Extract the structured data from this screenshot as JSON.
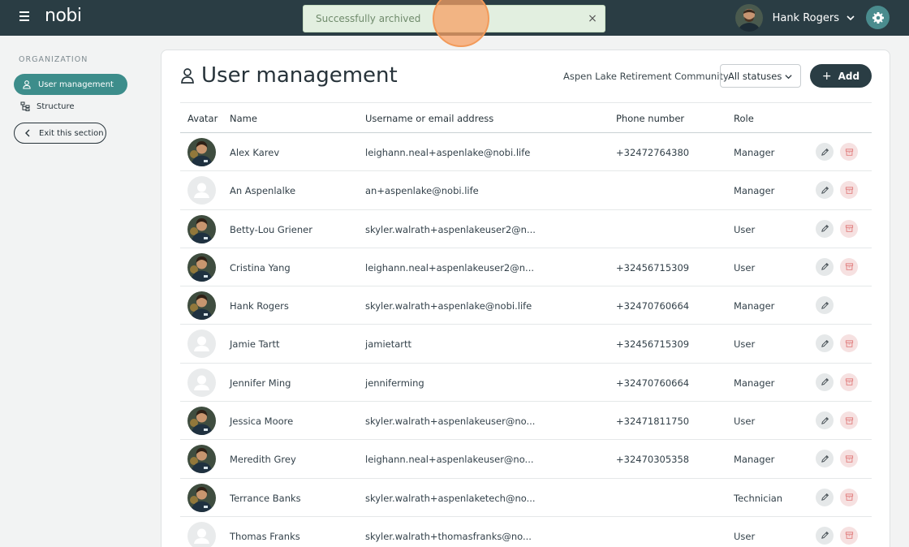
{
  "header": {
    "logo": "nobi",
    "user_name": "Hank Rogers",
    "brand_color": "#2a3d44",
    "accent_color": "#3d8d8b"
  },
  "toast": {
    "message": "Successfully archived",
    "close": "×"
  },
  "sidebar": {
    "section_label": "ORGANIZATION",
    "items": [
      {
        "label": "User management",
        "icon": "user-icon",
        "active": true
      },
      {
        "label": "Structure",
        "icon": "structure-icon",
        "active": false
      }
    ],
    "exit_label": "Exit this section"
  },
  "main": {
    "title": "User management",
    "facility": "Aspen Lake Retirement Community",
    "status_filter": "All statuses",
    "add_label": "Add",
    "columns": [
      "Avatar",
      "Name",
      "Username or email address",
      "Phone number",
      "Role"
    ],
    "rows": [
      {
        "name": "Alex Karev",
        "email": "leighann.neal+aspenlake@nobi.life",
        "phone": "+32472764380",
        "role": "Manager",
        "photo": true,
        "archivable": true
      },
      {
        "name": "An Aspenlalke",
        "email": "an+aspenlake@nobi.life",
        "phone": "",
        "role": "Manager",
        "photo": false,
        "archivable": true
      },
      {
        "name": "Betty-Lou Griener",
        "email": "skyler.walrath+aspenlakeuser2@n...",
        "phone": "",
        "role": "User",
        "photo": true,
        "archivable": true
      },
      {
        "name": "Cristina Yang",
        "email": "leighann.neal+aspenlakeuser2@n...",
        "phone": "+32456715309",
        "role": "User",
        "photo": true,
        "archivable": true
      },
      {
        "name": "Hank Rogers",
        "email": "skyler.walrath+aspenlake@nobi.life",
        "phone": "+32470760664",
        "role": "Manager",
        "photo": true,
        "archivable": false
      },
      {
        "name": "Jamie Tartt",
        "email": "jamietartt",
        "phone": "+32456715309",
        "role": "User",
        "photo": false,
        "archivable": true
      },
      {
        "name": "Jennifer Ming",
        "email": "jenniferming",
        "phone": "+32470760664",
        "role": "Manager",
        "photo": false,
        "archivable": true
      },
      {
        "name": "Jessica Moore",
        "email": "skyler.walrath+aspenlakeuser@no...",
        "phone": "+32471811750",
        "role": "User",
        "photo": true,
        "archivable": true
      },
      {
        "name": "Meredith Grey",
        "email": "leighann.neal+aspenlakeuser@no...",
        "phone": "+32470305358",
        "role": "Manager",
        "photo": true,
        "archivable": true
      },
      {
        "name": "Terrance Banks",
        "email": "skyler.walrath+aspenlaketech@no...",
        "phone": "",
        "role": "Technician",
        "photo": true,
        "archivable": true
      },
      {
        "name": "Thomas Franks",
        "email": "skyler.walrath+thomasfranks@no...",
        "phone": "",
        "role": "User",
        "photo": false,
        "archivable": true
      }
    ]
  }
}
